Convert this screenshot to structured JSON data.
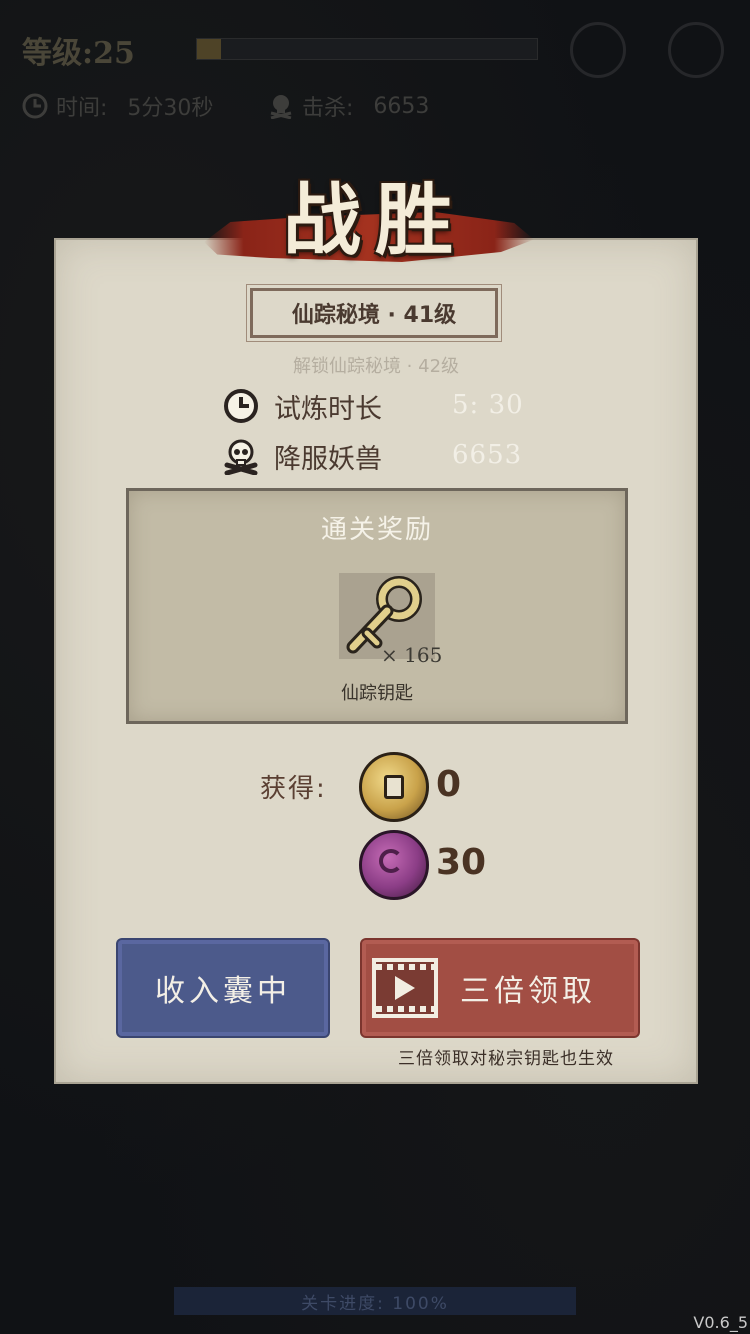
{
  "hud": {
    "level_label": "等级:25",
    "level_progress": 0.07,
    "time_label": "时间:",
    "time_value": "5分30秒",
    "kills_label": "击杀:",
    "kills_value": "6653"
  },
  "banner": {
    "title": "战胜"
  },
  "panel": {
    "stage_name": "仙踪秘境 · 41级",
    "unlock_text": "解锁仙踪秘境 · 42级",
    "stats": [
      {
        "icon": "clock-icon",
        "label": "试炼时长",
        "value": "5: 30"
      },
      {
        "icon": "skull-icon",
        "label": "降服妖兽",
        "value": "6653"
      }
    ],
    "reward": {
      "title": "通关奖励",
      "item_icon": "key-icon",
      "item_count": "× 165",
      "item_name": "仙踪钥匙"
    },
    "gain_label": "获得:",
    "gains": [
      {
        "icon": "gold-coin-icon",
        "value": "0"
      },
      {
        "icon": "purple-coin-icon",
        "value": "30"
      }
    ],
    "collect_button": "收入囊中",
    "triple_button": "三倍领取",
    "triple_note": "三倍领取对秘宗钥匙也生效"
  },
  "footer": {
    "stage_progress": "关卡进度: 100%",
    "version": "V0.6_5"
  },
  "colors": {
    "panel": "#ddd8c9",
    "button_blue": "#4c5a8b",
    "button_red": "#a24e44",
    "banner_red": "#a4321f"
  }
}
